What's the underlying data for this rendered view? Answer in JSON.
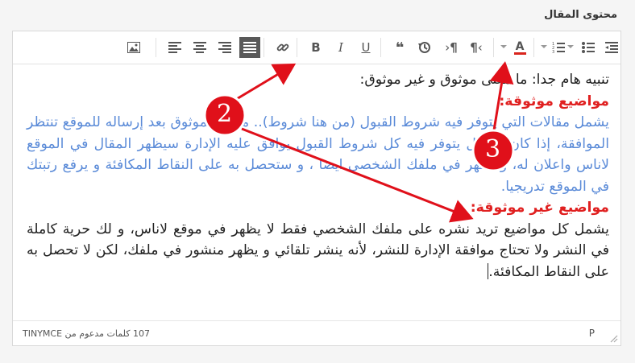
{
  "field_label": "محتوى المقال",
  "toolbar": {
    "buttons": [
      {
        "name": "indent-icon"
      },
      {
        "name": "bullet-list-icon"
      },
      {
        "name": "numbered-list-icon"
      },
      {
        "name": "text-color-icon",
        "glyph": "A",
        "accent": "#d9251d"
      },
      {
        "name": "paragraph-ltr-icon",
        "glyph": "¶"
      },
      {
        "name": "paragraph-rtl-icon",
        "glyph": "¶"
      },
      {
        "name": "history-icon"
      },
      {
        "name": "blockquote-icon",
        "glyph": "❝"
      },
      {
        "name": "underline-icon",
        "glyph": "U"
      },
      {
        "name": "italic-icon",
        "glyph": "I"
      },
      {
        "name": "bold-icon",
        "glyph": "B"
      },
      {
        "name": "link-icon"
      },
      {
        "name": "align-justify-icon"
      },
      {
        "name": "align-right-icon"
      },
      {
        "name": "align-center-icon"
      },
      {
        "name": "align-left-icon"
      },
      {
        "name": "image-icon"
      }
    ]
  },
  "content": {
    "intro": "تنبيه هام جدا: ما معنى موثوق و غير موثوق:",
    "heading_trusted": "مواضيع موثوقة:",
    "trusted_body": "يشمل مقالات التي يتوفر فيه شروط القبول (من هنا شروط).. مقال الموثوق بعد إرساله للموقع تنتظر الموافقة، إذا كان المقال يتوفر فيه كل شروط القبول يوافق عليه الإدارة سيظهر المقال في الموقع لاناس واعلان له، و يظهر في ملفك الشخصي ايضا ، و ستحصل به على النقاط المكافئة و يرفع رتبتك في الموقع تدريجيا.",
    "heading_untrusted": "مواضيع غير موثوقة:",
    "untrusted_body": "يشمل كل مواضيع تريد نشره على ملفك الشخصي فقط لا يظهر في موقع لاناس، و لك حرية كاملة في النشر ولا تحتاج موافقة الإدارة للنشر، لأنه ينشر تلقائي و يظهر منشور في ملفك، لكن لا تحصل به على النقاط المكافئة."
  },
  "statusbar": {
    "word_count": "107 كلمات مدعوم من TINYMCE",
    "path": "P"
  },
  "annotations": {
    "label_2": "2",
    "label_3": "3",
    "color": "#e0101a"
  }
}
